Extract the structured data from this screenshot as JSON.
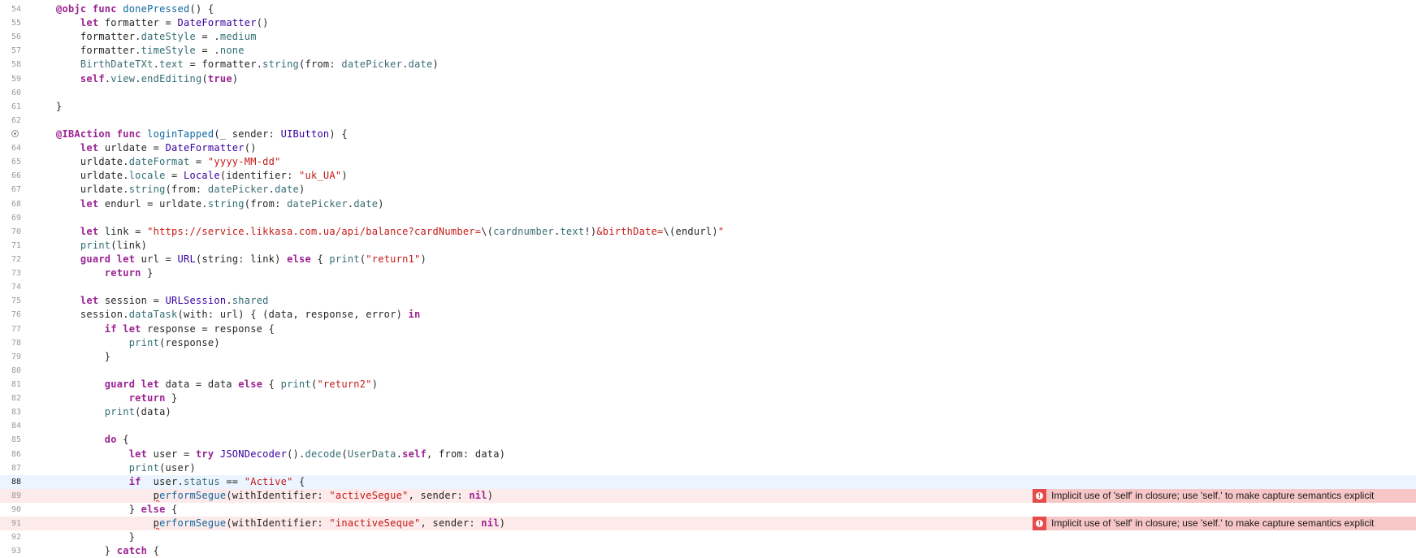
{
  "editor": {
    "language": "Swift",
    "current_line": "88",
    "error_icon": "error-circle-icon",
    "breakpoint_icon": "breakpoint-marker-icon",
    "lines": [
      {
        "n": "54",
        "tokens": [
          [
            "k",
            "@objc "
          ],
          [
            "k",
            "func "
          ],
          [
            "fn",
            "donePressed"
          ],
          [
            "",
            "() {"
          ]
        ]
      },
      {
        "n": "55",
        "tokens": [
          [
            "",
            "    "
          ],
          [
            "k",
            "let "
          ],
          [
            "",
            "formatter = "
          ],
          [
            "t",
            "DateFormatter"
          ],
          [
            "",
            "()"
          ]
        ]
      },
      {
        "n": "56",
        "tokens": [
          [
            "",
            "    formatter."
          ],
          [
            "p",
            "dateStyle"
          ],
          [
            "",
            " = ."
          ],
          [
            "p",
            "medium"
          ]
        ]
      },
      {
        "n": "57",
        "tokens": [
          [
            "",
            "    formatter."
          ],
          [
            "p",
            "timeStyle"
          ],
          [
            "",
            " = ."
          ],
          [
            "p",
            "none"
          ]
        ]
      },
      {
        "n": "58",
        "tokens": [
          [
            "",
            "    "
          ],
          [
            "m",
            "BirthDateTXt"
          ],
          [
            "",
            "."
          ],
          [
            "p",
            "text"
          ],
          [
            "",
            " = formatter."
          ],
          [
            "p",
            "string"
          ],
          [
            "",
            "(from: "
          ],
          [
            "m",
            "datePicker"
          ],
          [
            "",
            "."
          ],
          [
            "p",
            "date"
          ],
          [
            "",
            ")"
          ]
        ]
      },
      {
        "n": "59",
        "tokens": [
          [
            "",
            "    "
          ],
          [
            "k",
            "self"
          ],
          [
            "",
            "."
          ],
          [
            "p",
            "view"
          ],
          [
            "",
            "."
          ],
          [
            "p",
            "endEditing"
          ],
          [
            "",
            "("
          ],
          [
            "k",
            "true"
          ],
          [
            "",
            ")"
          ]
        ]
      },
      {
        "n": "60",
        "tokens": []
      },
      {
        "n": "61",
        "tokens": [
          [
            "",
            "}"
          ]
        ]
      },
      {
        "n": "62",
        "tokens": []
      },
      {
        "n": "63",
        "breakpoint": true,
        "tokens": [
          [
            "k",
            "@IBAction "
          ],
          [
            "k",
            "func "
          ],
          [
            "fn",
            "loginTapped"
          ],
          [
            "",
            "(_ sender: "
          ],
          [
            "t",
            "UIButton"
          ],
          [
            "",
            ") {"
          ]
        ]
      },
      {
        "n": "64",
        "tokens": [
          [
            "",
            "    "
          ],
          [
            "k",
            "let "
          ],
          [
            "",
            "urldate = "
          ],
          [
            "t",
            "DateFormatter"
          ],
          [
            "",
            "()"
          ]
        ]
      },
      {
        "n": "65",
        "tokens": [
          [
            "",
            "    urldate."
          ],
          [
            "p",
            "dateFormat"
          ],
          [
            "",
            " = "
          ],
          [
            "s",
            "\"yyyy-MM-dd\""
          ]
        ]
      },
      {
        "n": "66",
        "tokens": [
          [
            "",
            "    urldate."
          ],
          [
            "p",
            "locale"
          ],
          [
            "",
            " = "
          ],
          [
            "t",
            "Locale"
          ],
          [
            "",
            "(identifier: "
          ],
          [
            "s",
            "\"uk_UA\""
          ],
          [
            "",
            ")"
          ]
        ]
      },
      {
        "n": "67",
        "tokens": [
          [
            "",
            "    urldate."
          ],
          [
            "p",
            "string"
          ],
          [
            "",
            "(from: "
          ],
          [
            "m",
            "datePicker"
          ],
          [
            "",
            "."
          ],
          [
            "p",
            "date"
          ],
          [
            "",
            ")"
          ]
        ]
      },
      {
        "n": "68",
        "tokens": [
          [
            "",
            "    "
          ],
          [
            "k",
            "let "
          ],
          [
            "",
            "endurl = urldate."
          ],
          [
            "p",
            "string"
          ],
          [
            "",
            "(from: "
          ],
          [
            "m",
            "datePicker"
          ],
          [
            "",
            "."
          ],
          [
            "p",
            "date"
          ],
          [
            "",
            ")"
          ]
        ]
      },
      {
        "n": "69",
        "tokens": []
      },
      {
        "n": "70",
        "tokens": [
          [
            "",
            "    "
          ],
          [
            "k",
            "let "
          ],
          [
            "",
            "link = "
          ],
          [
            "s",
            "\"https://service.likkasa.com.ua/api/balance?cardNumber="
          ],
          [
            "",
            "\\("
          ],
          [
            "m",
            "cardnumber"
          ],
          [
            "",
            "."
          ],
          [
            "p",
            "text"
          ],
          [
            "",
            "!)"
          ],
          [
            "s",
            "&birthDate="
          ],
          [
            "",
            "\\(endurl)"
          ],
          [
            "s",
            "\""
          ]
        ]
      },
      {
        "n": "71",
        "tokens": [
          [
            "",
            "    "
          ],
          [
            "p",
            "print"
          ],
          [
            "",
            "(link)"
          ]
        ]
      },
      {
        "n": "72",
        "tokens": [
          [
            "",
            "    "
          ],
          [
            "k",
            "guard "
          ],
          [
            "k",
            "let "
          ],
          [
            "",
            "url = "
          ],
          [
            "t",
            "URL"
          ],
          [
            "",
            "(string: link) "
          ],
          [
            "k",
            "else "
          ],
          [
            "",
            "{ "
          ],
          [
            "p",
            "print"
          ],
          [
            "",
            "("
          ],
          [
            "s",
            "\"return1\""
          ],
          [
            "",
            ")"
          ]
        ]
      },
      {
        "n": "73",
        "tokens": [
          [
            "",
            "        "
          ],
          [
            "k",
            "return "
          ],
          [
            "",
            "}"
          ]
        ]
      },
      {
        "n": "74",
        "tokens": []
      },
      {
        "n": "75",
        "tokens": [
          [
            "",
            "    "
          ],
          [
            "k",
            "let "
          ],
          [
            "",
            "session = "
          ],
          [
            "t",
            "URLSession"
          ],
          [
            "",
            "."
          ],
          [
            "p",
            "shared"
          ]
        ]
      },
      {
        "n": "76",
        "tokens": [
          [
            "",
            "    session."
          ],
          [
            "p",
            "dataTask"
          ],
          [
            "",
            "(with: url) { (data, response, error) "
          ],
          [
            "k",
            "in"
          ]
        ]
      },
      {
        "n": "77",
        "tokens": [
          [
            "",
            "        "
          ],
          [
            "k",
            "if "
          ],
          [
            "k",
            "let "
          ],
          [
            "",
            "response = response {"
          ]
        ]
      },
      {
        "n": "78",
        "tokens": [
          [
            "",
            "            "
          ],
          [
            "p",
            "print"
          ],
          [
            "",
            "(response)"
          ]
        ]
      },
      {
        "n": "79",
        "tokens": [
          [
            "",
            "        }"
          ]
        ]
      },
      {
        "n": "80",
        "tokens": []
      },
      {
        "n": "81",
        "tokens": [
          [
            "",
            "        "
          ],
          [
            "k",
            "guard "
          ],
          [
            "k",
            "let "
          ],
          [
            "",
            "data = data "
          ],
          [
            "k",
            "else "
          ],
          [
            "",
            "{ "
          ],
          [
            "p",
            "print"
          ],
          [
            "",
            "("
          ],
          [
            "s",
            "\"return2\""
          ],
          [
            "",
            ")"
          ]
        ]
      },
      {
        "n": "82",
        "tokens": [
          [
            "",
            "            "
          ],
          [
            "k",
            "return "
          ],
          [
            "",
            "}"
          ]
        ]
      },
      {
        "n": "83",
        "tokens": [
          [
            "",
            "        "
          ],
          [
            "p",
            "print"
          ],
          [
            "",
            "(data)"
          ]
        ]
      },
      {
        "n": "84",
        "tokens": []
      },
      {
        "n": "85",
        "tokens": [
          [
            "",
            "        "
          ],
          [
            "k",
            "do "
          ],
          [
            "",
            "{"
          ]
        ]
      },
      {
        "n": "86",
        "tokens": [
          [
            "",
            "            "
          ],
          [
            "k",
            "let "
          ],
          [
            "",
            "user = "
          ],
          [
            "k",
            "try "
          ],
          [
            "t",
            "JSONDecoder"
          ],
          [
            "",
            "()."
          ],
          [
            "p",
            "decode"
          ],
          [
            "",
            "("
          ],
          [
            "m",
            "UserData"
          ],
          [
            "",
            "."
          ],
          [
            "k",
            "self"
          ],
          [
            "",
            ", from: data)"
          ]
        ]
      },
      {
        "n": "87",
        "tokens": [
          [
            "",
            "            "
          ],
          [
            "p",
            "print"
          ],
          [
            "",
            "(user)"
          ]
        ]
      },
      {
        "n": "88",
        "current": true,
        "tokens": [
          [
            "",
            "            "
          ],
          [
            "k",
            "if  "
          ],
          [
            "",
            "user."
          ],
          [
            "m",
            "status"
          ],
          [
            "",
            " == "
          ],
          [
            "s",
            "\"Active\""
          ],
          [
            "",
            " {"
          ]
        ]
      },
      {
        "n": "89",
        "error": "Implicit use of 'self' in closure; use 'self.' to make capture semantics explicit",
        "tokens": [
          [
            "",
            "                "
          ],
          [
            "squig",
            "p"
          ],
          [
            "fn",
            "erformSegue"
          ],
          [
            "",
            "(withIdentifier: "
          ],
          [
            "s",
            "\"activeSegue\""
          ],
          [
            "",
            ", sender: "
          ],
          [
            "k",
            "nil"
          ],
          [
            "",
            ")"
          ]
        ]
      },
      {
        "n": "90",
        "tokens": [
          [
            "",
            "            } "
          ],
          [
            "k",
            "else "
          ],
          [
            "",
            "{"
          ]
        ]
      },
      {
        "n": "91",
        "error": "Implicit use of 'self' in closure; use 'self.' to make capture semantics explicit",
        "tokens": [
          [
            "",
            "                "
          ],
          [
            "squig",
            "p"
          ],
          [
            "fn",
            "erformSegue"
          ],
          [
            "",
            "(withIdentifier: "
          ],
          [
            "s",
            "\"inactiveSeque\""
          ],
          [
            "",
            ", sender: "
          ],
          [
            "k",
            "nil"
          ],
          [
            "",
            ")"
          ]
        ]
      },
      {
        "n": "92",
        "tokens": [
          [
            "",
            "            }"
          ]
        ]
      },
      {
        "n": "93",
        "tokens": [
          [
            "",
            "        } "
          ],
          [
            "k",
            "catch "
          ],
          [
            "",
            "{"
          ]
        ]
      }
    ]
  }
}
